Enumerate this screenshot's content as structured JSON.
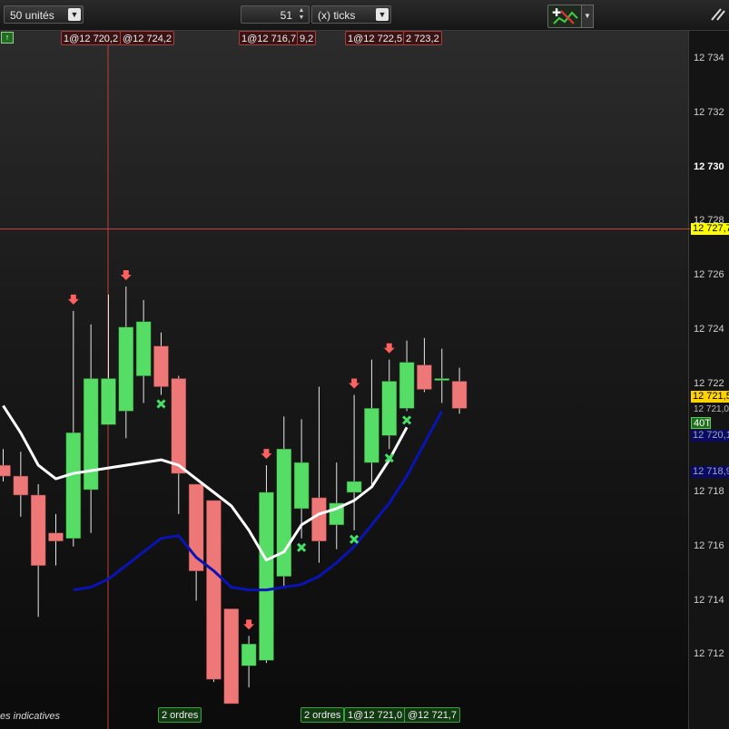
{
  "toolbar": {
    "units_label": "50 unités",
    "quantity_value": "51",
    "mode_label": "(x) ticks"
  },
  "price_axis": {
    "labels": [
      "12 734",
      "12 732",
      "12 730",
      "12 728",
      "12 726",
      "12 724",
      "12 722",
      "12 721,0",
      "12 718",
      "12 716",
      "12 714",
      "12 712"
    ],
    "cursor_price": "12 727,7",
    "last_price": "12 721,5",
    "tick_counter": "40T",
    "blue_tag_1": "12 720,1",
    "blue_tag_2": "12 718,9"
  },
  "top_orders": [
    {
      "label": "1@12 720,2"
    },
    {
      "label": "@12 724,2"
    },
    {
      "label": "1@12 716,7"
    },
    {
      "label": "9,2"
    },
    {
      "label": "1@12 722,5"
    },
    {
      "label": "2 723,2"
    }
  ],
  "bottom_orders": [
    {
      "label": "2 ordres"
    },
    {
      "label": "2 ordres"
    },
    {
      "label": "1@12 721,0"
    },
    {
      "label": "@12 721,7"
    }
  ],
  "footer_text": "es indicatives",
  "colors": {
    "bull": "#55dd66",
    "bear": "#ee7777",
    "ma_fast": "#ffffff",
    "ma_slow": "#0a14b4",
    "cursor_line": "#c04040"
  },
  "chart_data": {
    "type": "candlestick",
    "ylim": [
      12710.2,
      12735.6
    ],
    "candles": [
      {
        "o": 12719.0,
        "h": 12719.6,
        "l": 12718.4,
        "c": 12718.6
      },
      {
        "o": 12718.6,
        "h": 12719.5,
        "l": 12717.1,
        "c": 12717.9
      },
      {
        "o": 12717.9,
        "h": 12718.3,
        "l": 12713.4,
        "c": 12715.3
      },
      {
        "o": 12716.5,
        "h": 12717.2,
        "l": 12715.3,
        "c": 12716.2
      },
      {
        "o": 12716.3,
        "h": 12724.7,
        "l": 12716.0,
        "c": 12720.2
      },
      {
        "o": 12718.1,
        "h": 12724.2,
        "l": 12716.5,
        "c": 12722.2
      },
      {
        "o": 12720.5,
        "h": 12725.3,
        "l": 12720.5,
        "c": 12722.2
      },
      {
        "o": 12721.0,
        "h": 12725.6,
        "l": 12720.0,
        "c": 12724.1
      },
      {
        "o": 12722.3,
        "h": 12725.1,
        "l": 12721.3,
        "c": 12724.3
      },
      {
        "o": 12723.4,
        "h": 12723.9,
        "l": 12721.6,
        "c": 12721.9
      },
      {
        "o": 12722.2,
        "h": 12722.3,
        "l": 12717.2,
        "c": 12718.7
      },
      {
        "o": 12718.3,
        "h": 12718.3,
        "l": 12714.0,
        "c": 12715.1
      },
      {
        "o": 12717.7,
        "h": 12717.7,
        "l": 12711.0,
        "c": 12711.1
      },
      {
        "o": 12713.7,
        "h": 12713.7,
        "l": 12710.2,
        "c": 12710.2
      },
      {
        "o": 12711.6,
        "h": 12712.7,
        "l": 12710.8,
        "c": 12712.4
      },
      {
        "o": 12711.8,
        "h": 12719.0,
        "l": 12711.7,
        "c": 12718.0
      },
      {
        "o": 12714.9,
        "h": 12720.8,
        "l": 12714.5,
        "c": 12719.6
      },
      {
        "o": 12717.4,
        "h": 12720.7,
        "l": 12716.3,
        "c": 12719.1
      },
      {
        "o": 12717.8,
        "h": 12721.9,
        "l": 12715.4,
        "c": 12716.2
      },
      {
        "o": 12716.8,
        "h": 12719.1,
        "l": 12715.9,
        "c": 12717.6
      },
      {
        "o": 12718.0,
        "h": 12721.6,
        "l": 12716.6,
        "c": 12718.4
      },
      {
        "o": 12719.1,
        "h": 12722.9,
        "l": 12718.3,
        "c": 12721.1
      },
      {
        "o": 12720.1,
        "h": 12722.9,
        "l": 12719.6,
        "c": 12722.1
      },
      {
        "o": 12721.1,
        "h": 12723.6,
        "l": 12721.0,
        "c": 12722.8
      },
      {
        "o": 12722.7,
        "h": 12723.7,
        "l": 12721.7,
        "c": 12721.8
      },
      {
        "o": 12722.2,
        "h": 12723.3,
        "l": 12721.3,
        "c": 12722.2
      },
      {
        "o": 12722.1,
        "h": 12722.6,
        "l": 12720.9,
        "c": 12721.1
      }
    ],
    "ma_fast": [
      12721.2,
      12720.2,
      12719.0,
      12718.5,
      12718.7,
      12718.8,
      12718.9,
      12719.0,
      12719.1,
      12719.2,
      12719.0,
      12718.5,
      12718.0,
      12717.5,
      12716.6,
      12715.5,
      12715.8,
      12716.8,
      12717.2,
      12717.4,
      12717.7,
      12718.2,
      12719.2,
      12720.4
    ],
    "ma_slow": [
      12714.4,
      12714.5,
      12714.8,
      12715.3,
      12715.8,
      12716.3,
      12716.4,
      12715.6,
      12715.1,
      12714.5,
      12714.4,
      12714.4,
      12714.5,
      12714.6,
      12714.9,
      12715.4,
      12716.0,
      12716.8,
      12717.6,
      12718.6,
      12719.8,
      12721.0
    ],
    "sell_markers": [
      4,
      7,
      14,
      15,
      20,
      22
    ],
    "buy_markers": [
      9,
      17,
      20,
      22,
      23
    ]
  }
}
